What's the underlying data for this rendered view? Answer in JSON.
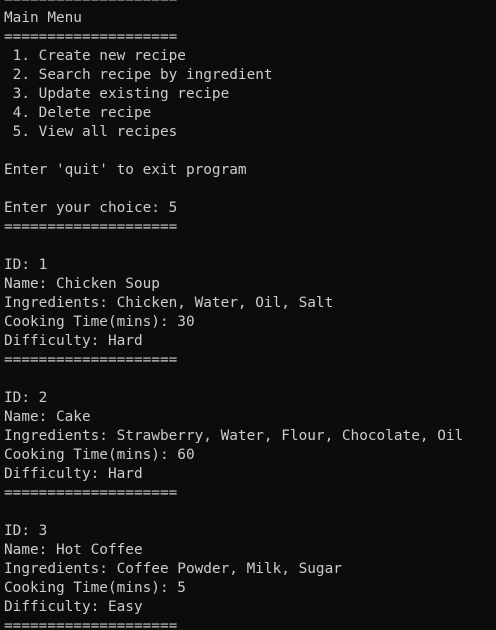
{
  "terminal": {
    "background": "#0c0c0c",
    "foreground": "#cccccc",
    "lines": [
      "====================",
      "Main Menu",
      "====================",
      " 1. Create new recipe",
      " 2. Search recipe by ingredient",
      " 3. Update existing recipe",
      " 4. Delete recipe",
      " 5. View all recipes",
      "",
      "Enter 'quit' to exit program",
      "",
      "Enter your choice: 5",
      "====================",
      "",
      "ID: 1",
      "Name: Chicken Soup",
      "Ingredients: Chicken, Water, Oil, Salt",
      "Cooking Time(mins): 30",
      "Difficulty: Hard",
      "====================",
      "",
      "ID: 2",
      "Name: Cake",
      "Ingredients: Strawberry, Water, Flour, Chocolate, Oil",
      "Cooking Time(mins): 60",
      "Difficulty: Hard",
      "====================",
      "",
      "ID: 3",
      "Name: Hot Coffee",
      "Ingredients: Coffee Powder, Milk, Sugar",
      "Cooking Time(mins): 5",
      "Difficulty: Easy",
      "===================="
    ]
  }
}
